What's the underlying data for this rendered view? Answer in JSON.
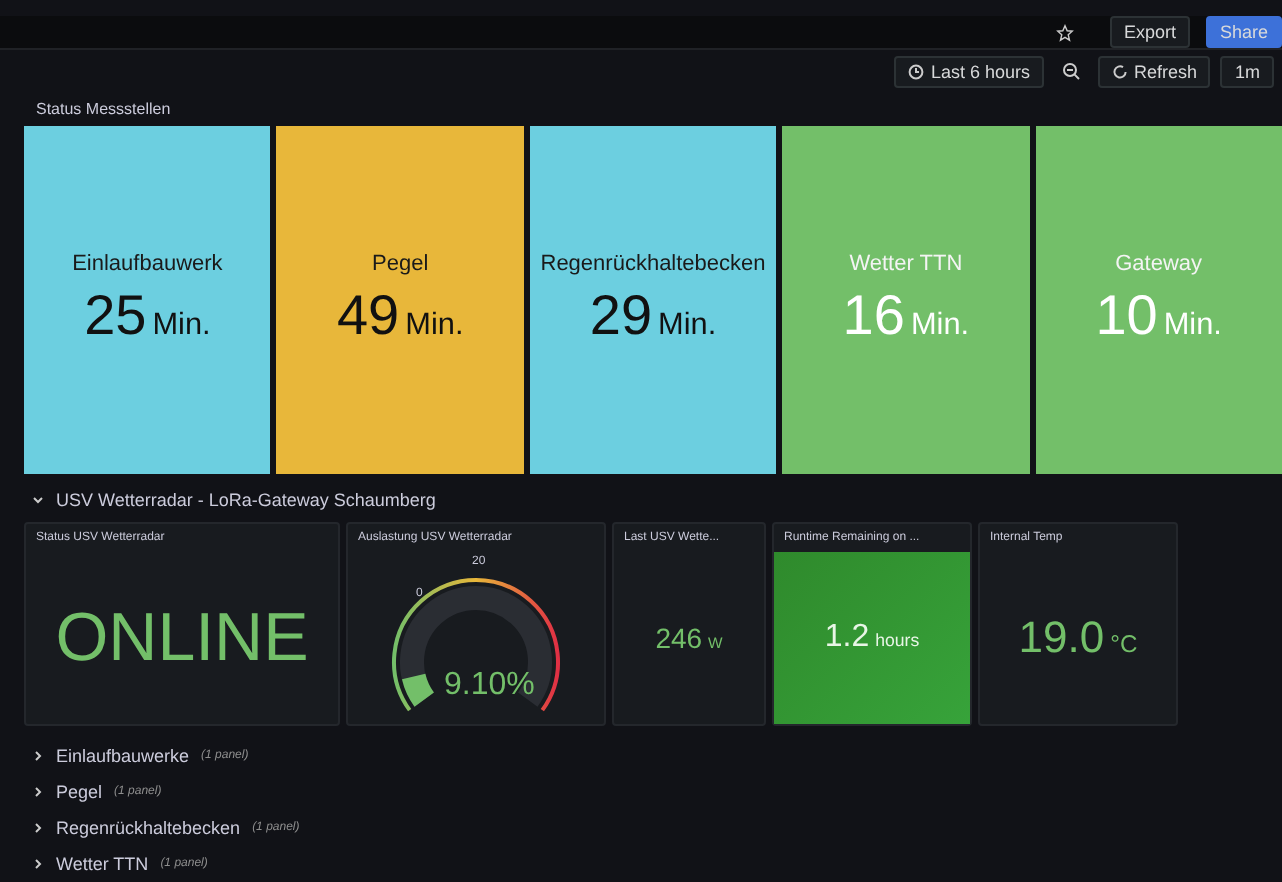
{
  "topbar": {
    "export": "Export",
    "share": "Share"
  },
  "toolbar": {
    "time_range": "Last 6 hours",
    "refresh": "Refresh",
    "interval": "1m"
  },
  "status_section": {
    "title": "Status Messstellen",
    "tiles": [
      {
        "name": "Einlaufbauwerk",
        "value": "25",
        "unit": "Min.",
        "color": "#6ccfe0"
      },
      {
        "name": "Pegel",
        "value": "49",
        "unit": "Min.",
        "color": "#e8b73a"
      },
      {
        "name": "Regenrückhaltebecken",
        "value": "29",
        "unit": "Min.",
        "color": "#6ccfe0"
      },
      {
        "name": "Wetter TTN",
        "value": "16",
        "unit": "Min.",
        "color": "#73bf69"
      },
      {
        "name": "Gateway",
        "value": "10",
        "unit": "Min.",
        "color": "#73bf69"
      }
    ]
  },
  "usv_row": {
    "title": "USV Wetterradar - LoRa-Gateway Schaumberg",
    "expanded": true,
    "panels": [
      {
        "kind": "text",
        "title": "Status USV Wetterradar",
        "value": "ONLINE"
      },
      {
        "kind": "gauge",
        "title": "Auslastung USV Wetterradar",
        "value": "9.10%",
        "ticks": [
          "0",
          "20"
        ]
      },
      {
        "kind": "stat",
        "title": "Last USV Wette...",
        "value": "246",
        "unit": "W",
        "filled": false
      },
      {
        "kind": "stat",
        "title": "Runtime Remaining on ...",
        "value": "1.2",
        "unit": "hours",
        "filled": true
      },
      {
        "kind": "stat",
        "title": "Internal Temp",
        "value": "19.0",
        "unit": "°C",
        "filled": false
      }
    ]
  },
  "collapsed_rows": [
    {
      "title": "Einlaufbauwerke",
      "count": "(1 panel)",
      "expanded": false
    },
    {
      "title": "Pegel",
      "count": "(1 panel)",
      "expanded": false
    },
    {
      "title": "Regenrückhaltebecken",
      "count": "(1 panel)",
      "expanded": false
    },
    {
      "title": "Wetter TTN",
      "count": "(1 panel)",
      "expanded": false
    }
  ]
}
